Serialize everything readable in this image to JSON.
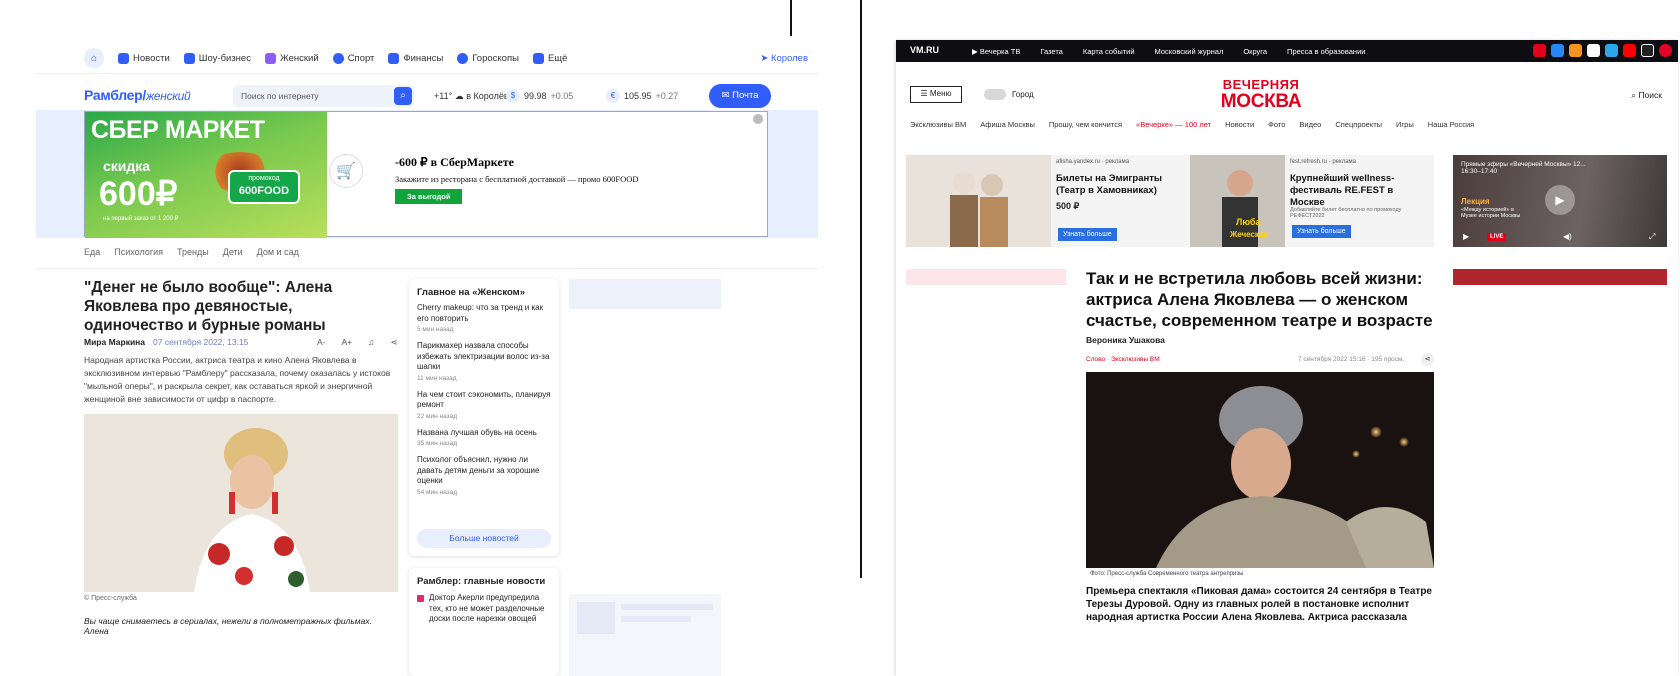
{
  "left": {
    "nav": [
      "Новости",
      "Шоу-бизнес",
      "Женский",
      "Спорт",
      "Финансы",
      "Гороскопы",
      "Ещё"
    ],
    "location": "Королев",
    "logo": "Рамблер/",
    "logo_section": "женский",
    "search_placeholder": "Поиск по интернету",
    "weather": "+11°",
    "weather_place": "в Королёве",
    "usd": "99.98",
    "usd_delta": "+0.05",
    "eur": "105.95",
    "eur_delta": "+0.27",
    "mail": "Почта",
    "ad": {
      "brand": "СБЕР МАРКЕТ",
      "sale": "скидка",
      "amount": "600₽",
      "sub": "на первый заказ от 1 200 ₽",
      "promo": "промокод",
      "code": "600FOOD",
      "title": "-600 ₽ в СберМаркете",
      "text": "Закажите из ресторана с бесплатной доставкой — промо 600FOOD",
      "button": "За выгодой"
    },
    "categories": [
      "Еда",
      "Психология",
      "Тренды",
      "Дети",
      "Дом и сад"
    ],
    "article": {
      "title": "\"Денег не было вообще\": Алена Яковлева про девяностые, одиночество и бурные романы",
      "author": "Мира Маркина",
      "date": "07 сентября 2022, 13:15",
      "lead": "Народная артистка России, актриса театра и кино Алена Яковлева в эксклюзивном интервью \"Рамблеру\" рассказала, почему оказалась у истоков \"мыльной оперы\", и раскрыла секрет, как оставаться яркой и энергичной женщиной вне зависимости от цифр в паспорте.",
      "credit": "© Пресс-служба",
      "lead2": "Вы чаще снимаетесь в сериалах, нежели в полнометражных фильмах. Алена"
    },
    "tools": [
      "A-",
      "A+",
      "♫",
      "⋖"
    ],
    "sidebar": {
      "title": "Главное на «Женском»",
      "items": [
        {
          "t": "Cherry makeup: что за тренд и как его повторить",
          "time": "5 мин назад"
        },
        {
          "t": "Парикмахер назвала способы избежать электризации волос из-за шапки",
          "time": "11 мин назад"
        },
        {
          "t": "На чем стоит сэкономить, планируя ремонт",
          "time": "22 мин назад"
        },
        {
          "t": "Названа лучшая обувь на осень",
          "time": "35 мин назад"
        },
        {
          "t": "Психолог объяснил, нужно ли давать детям деньги за хорошие оценки",
          "time": "54 мин назад"
        }
      ],
      "more": "Больше новостей"
    },
    "sidebar2": {
      "title": "Рамблер: главные новости",
      "item": "Доктор Акерли предупредила тех, кто не может разделочные доски после нарезки овощей"
    }
  },
  "right": {
    "logo": "VM.RU",
    "top": [
      "Вечерка ТВ",
      "Газета",
      "Карта событий",
      "Московский журнал",
      "Округа",
      "Пресса в образовании"
    ],
    "menu": "Меню",
    "city": "Город",
    "logo1": "ВЕЧЕРНЯЯ",
    "logo2": "МОСКВА",
    "search": "Поиск",
    "nav": [
      "Эксклюзивы ВМ",
      "Афиша Москвы",
      "Прошу, чем кончится",
      "«Вечерке» — 100 лет",
      "Новости",
      "Фото",
      "Видео",
      "Спецпроекты",
      "Игры",
      "Наша Россия"
    ],
    "card1": {
      "src": "afisha.yandex.ru · реклама",
      "title": "Билеты на Эмигранты (Театр в Хамовниках)",
      "price": "500 ₽",
      "btn": "Узнать больше"
    },
    "card2": {
      "src": "fest.refresh.ru · реклама",
      "title": "Крупнейший wellness-фестиваль RE.FEST в Москве",
      "desc": "Добавляйте билет бесплатно по промокоду РЕФЕСТ2022",
      "btn": "Узнать больше",
      "img_text": "Люба Жеческая"
    },
    "video": {
      "title": "Прямые эфиры «Вечерней Москвы» 12...",
      "time": "16:30–17:40",
      "label": "Лекция",
      "desc": "«Между историей» в Музее истории Москвы",
      "live": "LIVE"
    },
    "article": {
      "title": "Так и не встретила любовь всей жизни: актриса Алена Яковлева — о женском счастье, современном театре и возрасте",
      "author": "Вероника Ушакова",
      "rubric": "Эксклюзивы ВМ",
      "rubric0": "Слово",
      "date": "7 сентября 2022 15:16 · 195 просм.",
      "caption": "Фото: Пресс-служба Современного театра антрепризы",
      "lead": "Премьера спектакля «Пиковая дама» состоится 24 сентября в Театре Терезы Дуровой. Одну из главных ролей в постановке исполнит народная артистка России Алена Яковлева. Актриса рассказала"
    }
  }
}
